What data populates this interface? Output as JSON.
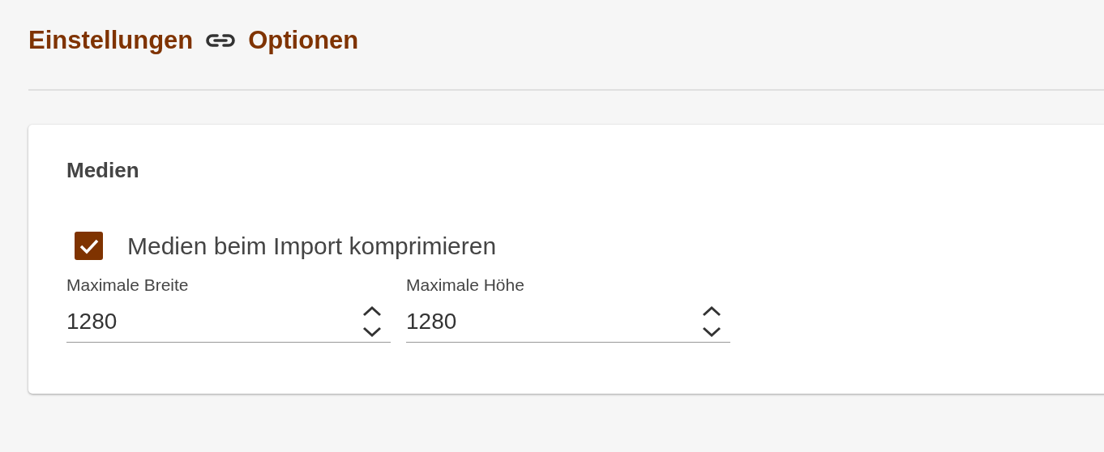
{
  "breadcrumb": [
    {
      "label": "Einstellungen"
    },
    {
      "label": "Optionen"
    }
  ],
  "section": {
    "title": "Medien",
    "checkbox": {
      "label": "Medien beim Import komprimieren",
      "checked": true
    },
    "fields": [
      {
        "label": "Maximale Breite",
        "value": "1280"
      },
      {
        "label": "Maximale Höhe",
        "value": "1280"
      }
    ]
  }
}
